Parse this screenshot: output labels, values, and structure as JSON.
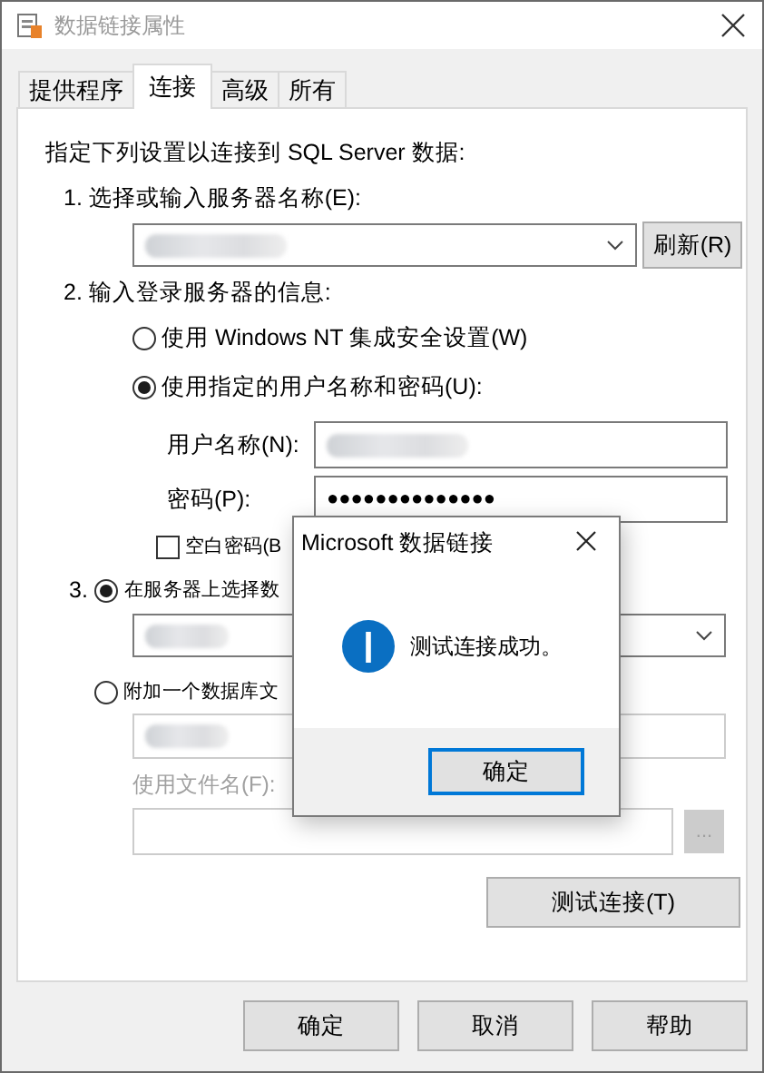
{
  "window": {
    "title": "数据链接属性"
  },
  "tabs": [
    {
      "label": "提供程序",
      "selected": false
    },
    {
      "label": "连接",
      "selected": true
    },
    {
      "label": "高级",
      "selected": false
    },
    {
      "label": "所有",
      "selected": false
    }
  ],
  "connection": {
    "intro": "指定下列设置以连接到 SQL Server 数据:",
    "step1": {
      "label": "1. 选择或输入服务器名称(E):",
      "server": {
        "redacted": true
      },
      "refresh_button": "刷新(R)"
    },
    "step2": {
      "label": "2. 输入登录服务器的信息:",
      "options": [
        {
          "label": "使用 Windows NT 集成安全设置(W)",
          "selected": false
        },
        {
          "label": "使用指定的用户名称和密码(U):",
          "selected": true
        }
      ],
      "username": {
        "label": "用户名称(N):",
        "redacted": true
      },
      "password": {
        "label": "密码(P):",
        "value": "●●●●●●●●●●●●●●"
      },
      "blank_password": {
        "label": "空白密码(B",
        "checked": false
      }
    },
    "step3": {
      "number": "3.",
      "options": [
        {
          "label": "在服务器上选择数",
          "selected": true
        },
        {
          "label": "附加一个数据库文",
          "selected": false
        }
      ],
      "database": {
        "redacted": true
      },
      "attach_file": {
        "redacted": true
      },
      "filename": {
        "label": "使用文件名(F):"
      },
      "browse_button": "..."
    },
    "test_button": "测试连接(T)"
  },
  "buttons": [
    "确定",
    "取消",
    "帮助"
  ],
  "message_box": {
    "title": "Microsoft 数据链接",
    "message": "测试连接成功。",
    "button": "确定"
  }
}
